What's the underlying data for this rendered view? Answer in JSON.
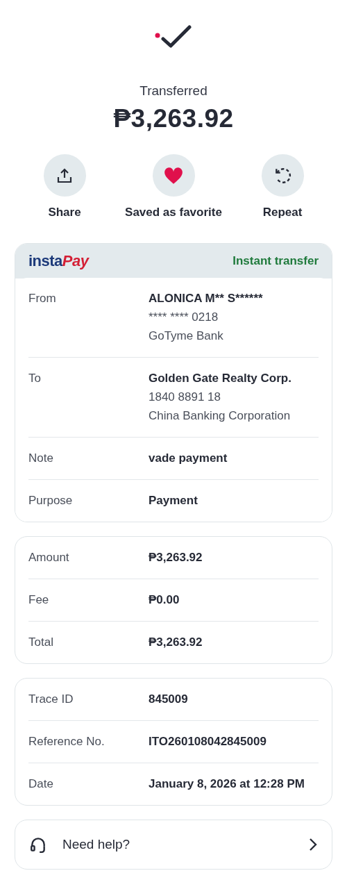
{
  "status": {
    "title": "Transferred",
    "amount": "₱3,263.92"
  },
  "actions": [
    {
      "kind": "share",
      "label": "Share"
    },
    {
      "kind": "favorite",
      "label": "Saved as favorite",
      "on": true
    },
    {
      "kind": "repeat",
      "label": "Repeat"
    }
  ],
  "transfer_card": {
    "logo": {
      "part_1": "insta",
      "part_2": "Pay"
    },
    "badge": "Instant transfer",
    "rows": [
      {
        "label": "From",
        "value": "ALONICA M** S******",
        "details": [
          "**** **** 0218",
          "GoTyme Bank"
        ]
      },
      {
        "label": "To",
        "value": "Golden Gate Realty Corp.",
        "details": [
          "1840 8891 18",
          "China Banking Corporation"
        ]
      },
      {
        "label": "Note",
        "value": "vade payment"
      },
      {
        "label": "Purpose",
        "value": "Payment"
      }
    ]
  },
  "amount_card": {
    "rows": [
      {
        "label": "Amount",
        "value": "₱3,263.92"
      },
      {
        "label": "Fee",
        "value": "₱0.00"
      },
      {
        "label": "Total",
        "value": "₱3,263.92"
      }
    ]
  },
  "reference_card": {
    "rows": [
      {
        "label": "Trace ID",
        "value": "845009"
      },
      {
        "label": "Reference No.",
        "value": "ITO260108042845009"
      },
      {
        "label": "Date",
        "value": "January 8, 2026 at 12:28 PM"
      }
    ]
  },
  "help": {
    "label": "Need help?"
  }
}
